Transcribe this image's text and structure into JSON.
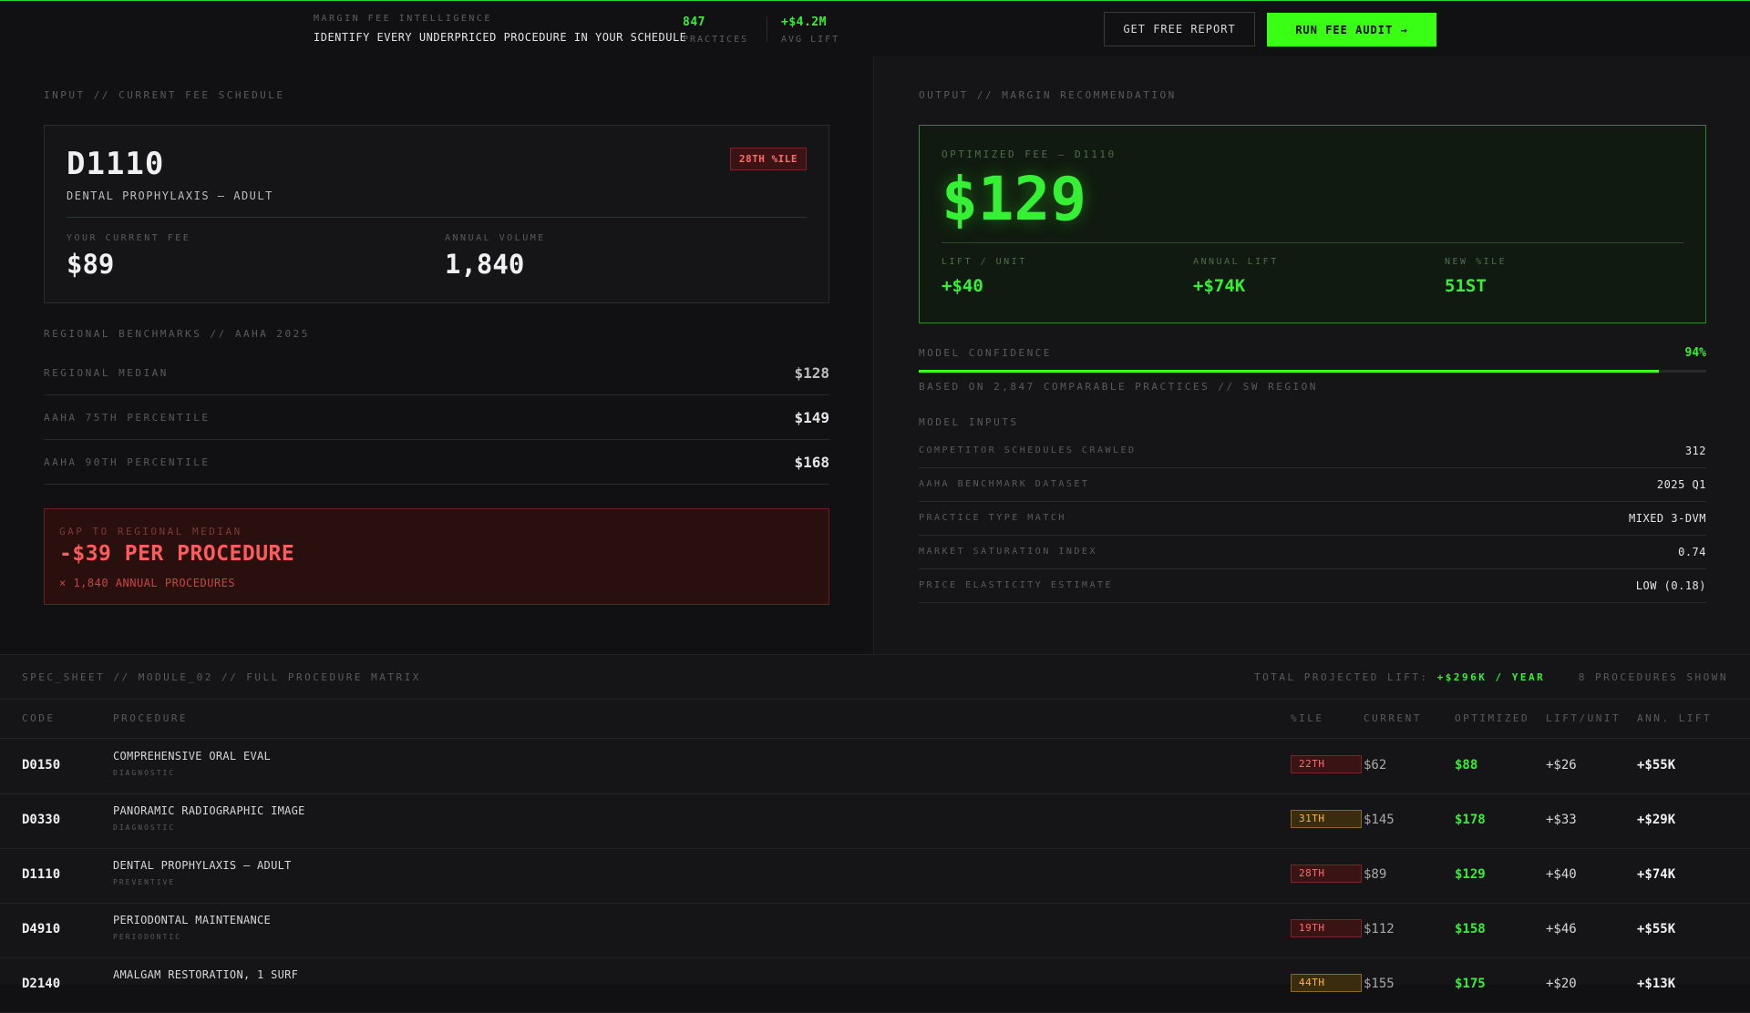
{
  "header": {
    "kicker": "MARGIN FEE INTELLIGENCE",
    "headline": "IDENTIFY EVERY UNDERPRICED PROCEDURE IN YOUR SCHEDULE",
    "stats": [
      {
        "value": "847",
        "label": "PRACTICES"
      },
      {
        "value": "+$4.2M",
        "label": "AVG LIFT"
      }
    ],
    "buttons": {
      "free_report": "GET FREE REPORT",
      "run_audit": "RUN FEE AUDIT →"
    }
  },
  "input": {
    "section_label": "INPUT // CURRENT FEE SCHEDULE",
    "code": "D1110",
    "name": "DENTAL PROPHYLAXIS — ADULT",
    "percentile_badge": "28TH %ILE",
    "current_fee_label": "YOUR CURRENT FEE",
    "current_fee": "$89",
    "annual_volume_label": "ANNUAL VOLUME",
    "annual_volume": "1,840",
    "benchmarks_label": "REGIONAL BENCHMARKS // AAHA 2025",
    "benchmarks": [
      {
        "label": "REGIONAL MEDIAN",
        "value": "$128"
      },
      {
        "label": "AAHA 75TH PERCENTILE",
        "value": "$149"
      },
      {
        "label": "AAHA 90TH PERCENTILE",
        "value": "$168"
      }
    ],
    "gap": {
      "label": "GAP TO REGIONAL MEDIAN",
      "value": "-$39 PER PROCEDURE",
      "sub": "× 1,840 ANNUAL PROCEDURES"
    }
  },
  "output": {
    "section_label": "OUTPUT // MARGIN RECOMMENDATION",
    "optimized_label": "OPTIMIZED FEE — D1110",
    "optimized_fee": "$129",
    "metrics": [
      {
        "label": "LIFT / UNIT",
        "value": "+$40"
      },
      {
        "label": "ANNUAL LIFT",
        "value": "+$74K"
      },
      {
        "label": "NEW %ILE",
        "value": "51ST"
      }
    ],
    "confidence_label": "MODEL CONFIDENCE",
    "confidence_value": "94%",
    "confidence_fraction": 0.94,
    "confidence_note": "BASED ON 2,847 COMPARABLE PRACTICES // SW REGION",
    "inputs_label": "MODEL INPUTS",
    "inputs": [
      {
        "label": "COMPETITOR SCHEDULES CRAWLED",
        "value": "312"
      },
      {
        "label": "AAHA BENCHMARK DATASET",
        "value": "2025 Q1"
      },
      {
        "label": "PRACTICE TYPE MATCH",
        "value": "MIXED 3-DVM"
      },
      {
        "label": "MARKET SATURATION INDEX",
        "value": "0.74"
      },
      {
        "label": "PRICE ELASTICITY ESTIMATE",
        "value": "LOW (0.18)"
      }
    ]
  },
  "matrix": {
    "title": "SPEC_SHEET // MODULE_02 // FULL PROCEDURE MATRIX",
    "total_prefix": "TOTAL PROJECTED LIFT:",
    "total_value": "+$296K / YEAR",
    "shown": "8 PROCEDURES SHOWN",
    "columns": {
      "code": "CODE",
      "procedure": "PROCEDURE",
      "pct": "%ILE",
      "current": "CURRENT",
      "optimized": "OPTIMIZED",
      "lift": "LIFT/UNIT",
      "annual": "ANN. LIFT"
    },
    "rows": [
      {
        "code": "D0150",
        "procedure": "COMPREHENSIVE ORAL EVAL",
        "category": "DIAGNOSTIC",
        "pct": "22TH",
        "pct_level": "red",
        "current": "$62",
        "optimized": "$88",
        "lift": "+$26",
        "annual": "+$55K"
      },
      {
        "code": "D0330",
        "procedure": "PANORAMIC RADIOGRAPHIC IMAGE",
        "category": "DIAGNOSTIC",
        "pct": "31TH",
        "pct_level": "amber",
        "current": "$145",
        "optimized": "$178",
        "lift": "+$33",
        "annual": "+$29K"
      },
      {
        "code": "D1110",
        "procedure": "DENTAL PROPHYLAXIS — ADULT",
        "category": "PREVENTIVE",
        "pct": "28TH",
        "pct_level": "red",
        "current": "$89",
        "optimized": "$129",
        "lift": "+$40",
        "annual": "+$74K"
      },
      {
        "code": "D4910",
        "procedure": "PERIODONTAL MAINTENANCE",
        "category": "PERIODONTIC",
        "pct": "19TH",
        "pct_level": "red",
        "current": "$112",
        "optimized": "$158",
        "lift": "+$46",
        "annual": "+$55K"
      },
      {
        "code": "D2140",
        "procedure": "AMALGAM RESTORATION, 1 SURF",
        "category": "",
        "pct": "44TH",
        "pct_level": "amber",
        "current": "$155",
        "optimized": "$175",
        "lift": "+$20",
        "annual": "+$13K"
      }
    ]
  }
}
